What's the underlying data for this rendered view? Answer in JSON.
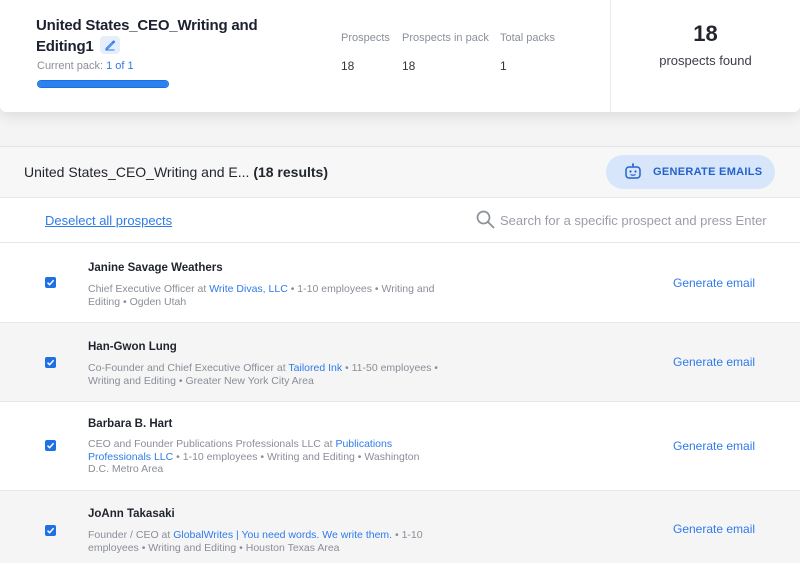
{
  "pack": {
    "title": "United States_CEO_Writing and Editing1",
    "current_pack_label": "Current pack:",
    "current_pack_value": "1 of 1",
    "progress_percent": 100
  },
  "stats": [
    {
      "label": "Prospects",
      "value": "18"
    },
    {
      "label": "Prospects in pack",
      "value": "18"
    },
    {
      "label": "Total packs",
      "value": "1"
    }
  ],
  "found": {
    "count": "18",
    "label": "prospects found"
  },
  "results": {
    "title": "United States_CEO_Writing and E...",
    "count": "(18 results)",
    "generate_all_label": "GENERATE EMAILS",
    "deselect_label": "Deselect all prospects",
    "search_placeholder": "Search for a specific prospect and press Enter"
  },
  "prospects": [
    {
      "name": "Janine Savage Weathers",
      "role": "Chief Executive Officer at ",
      "company": "Write Divas, LLC",
      "details": " • 1-10 employees • Writing and Editing • Ogden Utah",
      "checked": true,
      "action": "Generate email"
    },
    {
      "name": "Han-Gwon Lung",
      "role": "Co-Founder and Chief Executive Officer at ",
      "company": "Tailored Ink",
      "details": " • 11-50 employees • Writing and Editing • Greater New York City Area",
      "checked": true,
      "action": "Generate email"
    },
    {
      "name": "Barbara B. Hart",
      "role": "CEO and Founder Publications Professionals LLC at ",
      "company": "Publications Professionals LLC",
      "details": " • 1-10 employees • Writing and Editing • Washington D.C. Metro Area",
      "checked": true,
      "action": "Generate email"
    },
    {
      "name": "JoAnn Takasaki",
      "role": "Founder / CEO at ",
      "company": "GlobalWrites | You need words. We write them.",
      "details": " • 1-10 employees • Writing and Editing • Houston Texas Area",
      "checked": true,
      "action": "Generate email"
    }
  ],
  "colors": {
    "accent": "#2f7be8",
    "progress": "#2a82f0",
    "button_bg": "#d8e6fb"
  },
  "icons": {
    "edit": "pencil-icon",
    "search": "search-icon",
    "generate": "robot-icon",
    "checkbox": "check-icon"
  }
}
